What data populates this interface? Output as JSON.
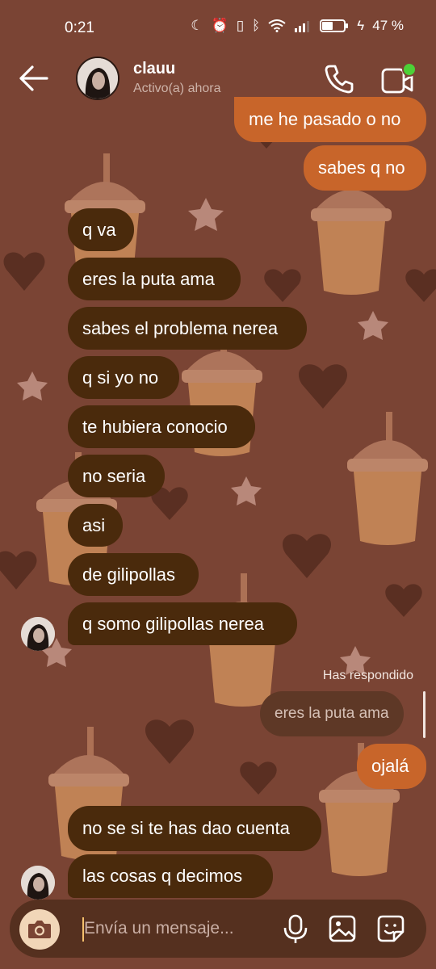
{
  "status_bar": {
    "time": "0:21",
    "battery": "47 %"
  },
  "header": {
    "contact_name": "clauu",
    "contact_status": "Activo(a) ahora"
  },
  "messages": {
    "sent_1": "me he pasado o no",
    "sent_2": "sabes q no",
    "recv_1": "q va",
    "recv_2": "eres la puta ama",
    "recv_3": "sabes el problema nerea",
    "recv_4": "q si yo no",
    "recv_5": "te hubiera conocio",
    "recv_6": "no seria",
    "recv_7": "asi",
    "recv_8": "de gilipollas",
    "recv_9": "q somo gilipollas nerea",
    "reply_label": "Has respondido",
    "reply_quote": "eres la puta ama",
    "sent_3": "ojalá",
    "recv_10": "no se si te has dao cuenta",
    "recv_11": "las cosas q decimos"
  },
  "composer": {
    "placeholder": "Envía un mensaje..."
  },
  "colors": {
    "background": "#7a4434",
    "received_bubble": "#4a2a0c",
    "sent_bubble": "#c8652a",
    "online_dot": "#4cd137"
  }
}
